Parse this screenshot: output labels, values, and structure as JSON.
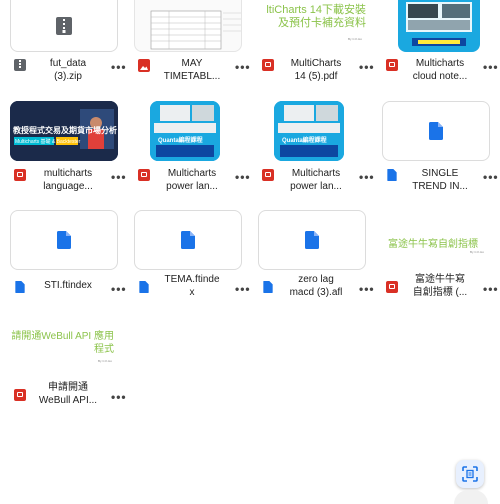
{
  "files": [
    {
      "name": "fut_data\n(3).zip",
      "type": "zip"
    },
    {
      "name": "MAY\nTIMETABL...",
      "type": "img"
    },
    {
      "name": "MultiCharts\n14 (5).pdf",
      "type": "pdf"
    },
    {
      "name": "Multicharts\ncloud note...",
      "type": "pdf"
    },
    {
      "name": "multicharts\nlanguage...",
      "type": "pdf"
    },
    {
      "name": "Multicharts\npower lan...",
      "type": "pdf"
    },
    {
      "name": "Multicharts\npower lan...",
      "type": "pdf"
    },
    {
      "name": "SINGLE\nTREND IN...",
      "type": "doc"
    },
    {
      "name": "STI.ftindex",
      "type": "doc"
    },
    {
      "name": "TEMA.ftinde\nx",
      "type": "doc"
    },
    {
      "name": "zero lag\nmacd (3).afl",
      "type": "doc"
    },
    {
      "name": "富途牛牛寫\n自創指標 (...",
      "type": "pdf"
    },
    {
      "name": "申請開通\nWeBull API...",
      "type": "pdf"
    }
  ],
  "thumbs": {
    "multicharts14_title": "ltiCharts 14下載安裝\n及預付卡補充資料",
    "multicharts14_by": "By C.K.Ho",
    "language_title": "教授程式交易及期貨市場分析",
    "language_sub": "Multicharts 基礎 & Backtester",
    "power_title": "Quanta編程課程",
    "futu_title": "富途牛牛寫自創指標",
    "futu_by": "By C.K.Ho",
    "webull_title": "請開通WeBull API 應用\n程式",
    "webull_by": "By C.K.Ho"
  },
  "more_label": "•••",
  "colors": {
    "pdf_red": "#d93025",
    "doc_blue": "#1a73e8",
    "green_text": "#8bc34a",
    "cyan_banner": "#1aa8e0"
  }
}
